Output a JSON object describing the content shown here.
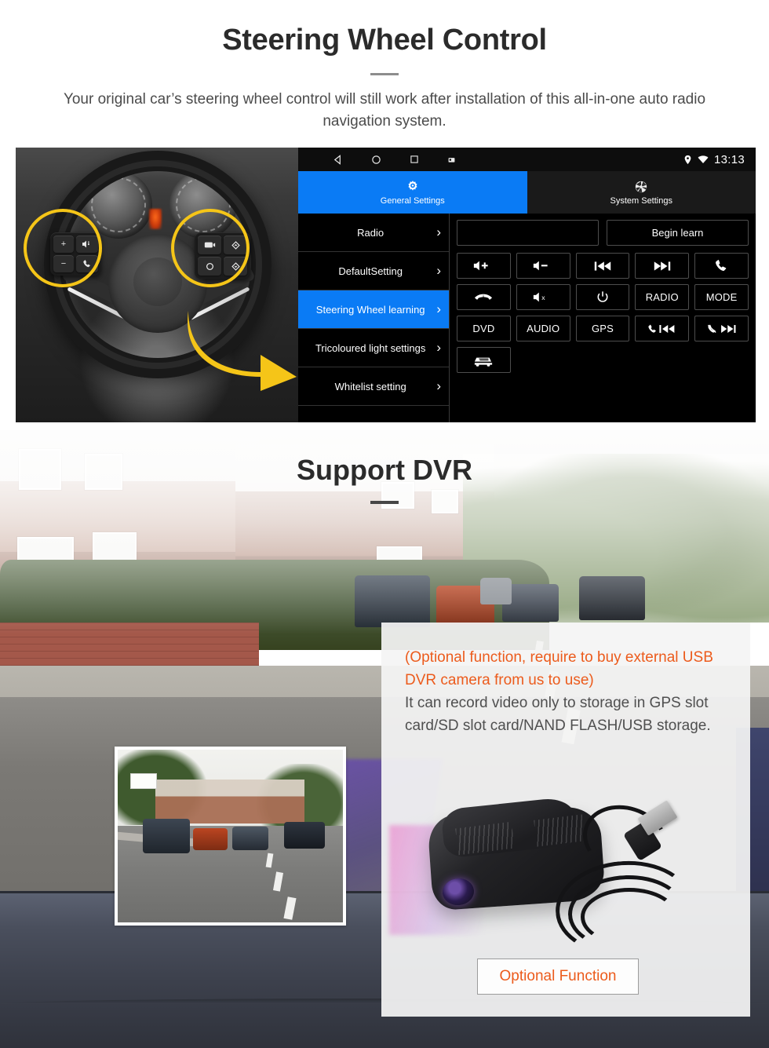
{
  "section_steering": {
    "title": "Steering Wheel Control",
    "subtitle": "Your original car’s steering wheel control will still work after installation of this all-in-one auto radio navigation system.",
    "head_unit": {
      "status_bar": {
        "back_icon": "back-triangle-icon",
        "home_icon": "home-circle-icon",
        "recents_icon": "recents-square-icon",
        "screenshot_icon": "screenshot-icon",
        "location_icon": "location-pin-icon",
        "wifi_icon": "wifi-icon",
        "time": "13:13"
      },
      "tabs": [
        {
          "label": "General Settings",
          "icon": "gear-icon",
          "active": true
        },
        {
          "label": "System Settings",
          "icon": "system-shutter-icon",
          "active": false
        }
      ],
      "menu_items": [
        {
          "label": "Radio",
          "selected": false
        },
        {
          "label": "DefaultSetting",
          "selected": false
        },
        {
          "label": "Steering Wheel learning",
          "selected": true
        },
        {
          "label": "Tricoloured light settings",
          "selected": false
        },
        {
          "label": "Whitelist setting",
          "selected": false
        }
      ],
      "learn_value": "",
      "learn_button": "Begin learn",
      "function_buttons": [
        {
          "label": "",
          "icon": "volume-up-icon"
        },
        {
          "label": "",
          "icon": "volume-down-icon"
        },
        {
          "label": "",
          "icon": "previous-track-icon"
        },
        {
          "label": "",
          "icon": "next-track-icon"
        },
        {
          "label": "",
          "icon": "phone-answer-icon"
        },
        {
          "label": "",
          "icon": "phone-hangup-icon"
        },
        {
          "label": "",
          "icon": "mute-icon"
        },
        {
          "label": "",
          "icon": "power-icon"
        },
        {
          "label": "RADIO",
          "icon": ""
        },
        {
          "label": "MODE",
          "icon": ""
        },
        {
          "label": "DVD",
          "icon": ""
        },
        {
          "label": "AUDIO",
          "icon": ""
        },
        {
          "label": "GPS",
          "icon": ""
        },
        {
          "label": "",
          "icon": "phone-previous-icon"
        },
        {
          "label": "",
          "icon": "phone-reject-next-icon"
        },
        {
          "label": "",
          "icon": "car-info-icon"
        }
      ],
      "colors": {
        "accent_blue": "#0a7bf5",
        "background": "#000000",
        "border": "#4d4d4d"
      }
    },
    "photo": {
      "left_pod_keys": [
        "+",
        "-",
        "volume-speaker-icon",
        "phone-answer-icon"
      ],
      "right_pod_keys": [
        "media-icon",
        "diamond-up-icon",
        "circle-icon",
        "diamond-down-icon"
      ],
      "highlight_color": "#f5c518",
      "arrow_color": "#f5c518"
    }
  },
  "section_dvr": {
    "title": "Support DVR",
    "card": {
      "orange_text": "(Optional function, require to buy external USB DVR camera from us to use)",
      "grey_text": "It can record video only to storage in GPS slot card/SD slot card/NAND FLASH/USB storage.",
      "button_label": "Optional Function",
      "orange_color": "#ec5b1c"
    }
  }
}
